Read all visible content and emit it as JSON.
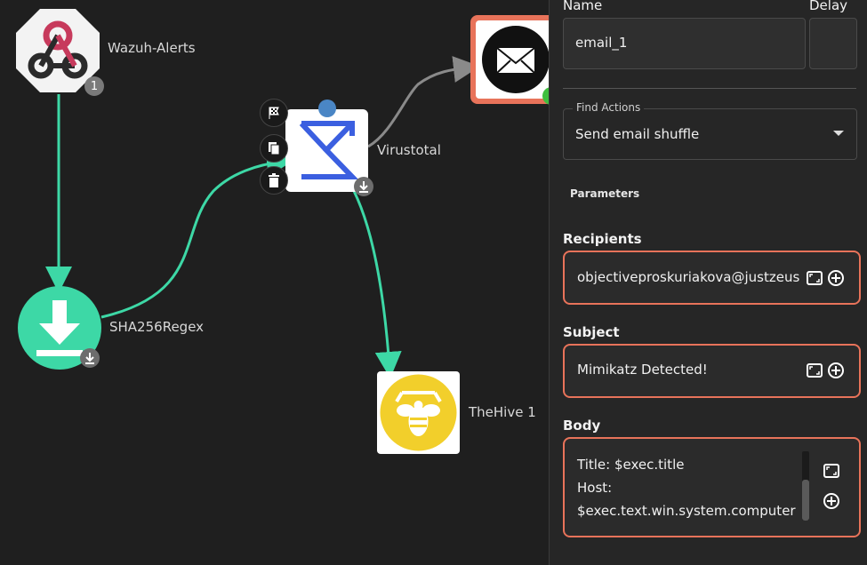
{
  "canvas": {
    "nodes": {
      "wazuh": {
        "label": "Wazuh-Alerts",
        "badge": "1"
      },
      "sha": {
        "label": "SHA256Regex"
      },
      "virustotal": {
        "label": "Virustotal"
      },
      "thehive": {
        "label": "TheHive 1"
      },
      "email": {
        "label": ""
      }
    }
  },
  "panel": {
    "name_label": "Name",
    "delay_label": "Delay",
    "name_value": "email_1",
    "delay_value": "",
    "find_actions_label": "Find Actions",
    "find_actions_value": "Send email shuffle",
    "parameters_heading": "Parameters",
    "recipients": {
      "label": "Recipients",
      "value": "objectiveproskuriakova@justzeus.c"
    },
    "subject": {
      "label": "Subject",
      "value": "Mimikatz Detected!"
    },
    "body": {
      "label": "Body",
      "lines": [
        "Title: $exec.title",
        "Host:",
        "$exec.text.win.system.computer"
      ]
    }
  },
  "colors": {
    "edge": "#3dd8a6",
    "edge_gray": "#888888",
    "accent_border": "#e8735a",
    "selected_dot": "#4a86c5"
  }
}
